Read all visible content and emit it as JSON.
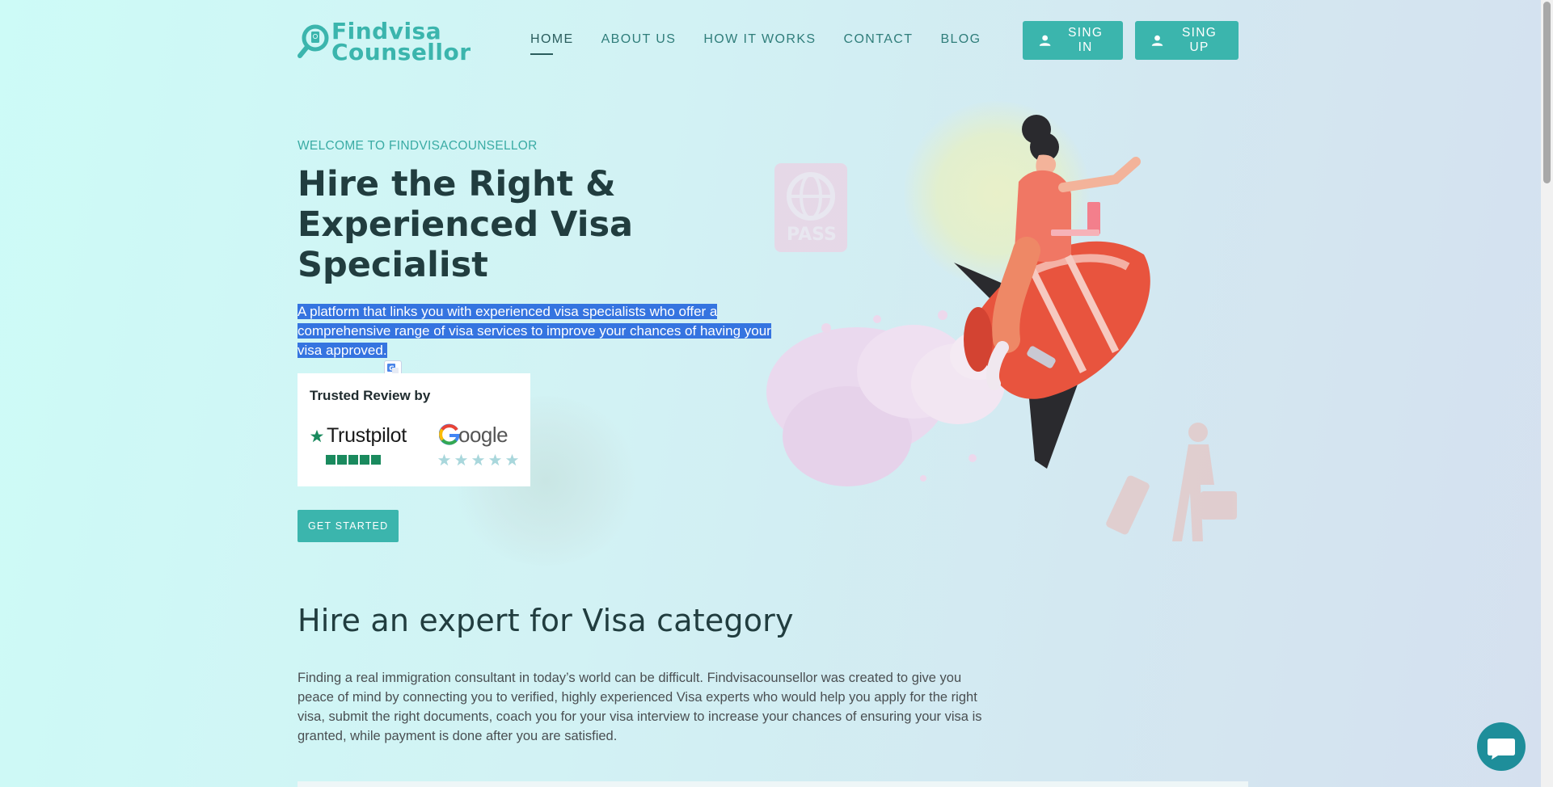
{
  "header": {
    "logo_line1": "Findvisa",
    "logo_line2": "Counsellor",
    "nav": [
      {
        "label": "HOME"
      },
      {
        "label": "ABOUT US"
      },
      {
        "label": "HOW IT WORKS"
      },
      {
        "label": "CONTACT"
      },
      {
        "label": "BLOG"
      }
    ],
    "signin_label": "SING IN",
    "signup_label": "SING UP"
  },
  "hero": {
    "eyebrow": "WELCOME TO FINDVISACOUNSELLOR",
    "title": "Hire the Right & Experienced Visa Specialist",
    "lead": "A platform that links you with experienced visa specialists who offer a comprehensive range of visa services to improve your chances of having your visa approved.",
    "review_title": "Trusted Review by",
    "trustpilot_label": "Trustpilot",
    "google_label": "Google",
    "cta_label": "GET STARTED",
    "passport_text": "PASS"
  },
  "section": {
    "title": "Hire an expert for Visa category",
    "body": "Finding a real immigration consultant in today’s world can be difficult. Findvisacounsellor was created to give you peace of mind by connecting you to verified, highly experienced Visa experts who would help you apply for the right visa, submit the right documents, coach you for your visa interview to increase your chances of ensuring your visa is granted, while payment is done after you are satisfied."
  },
  "colors": {
    "accent": "#3bb5ad",
    "heading": "#213d3f",
    "selection": "#3574e0",
    "chat": "#1e8e9a"
  },
  "icons": [
    "magnifier-logo-icon",
    "user-icon",
    "translate-icon",
    "trustpilot-star-icon",
    "google-g-icon",
    "chat-icon"
  ]
}
